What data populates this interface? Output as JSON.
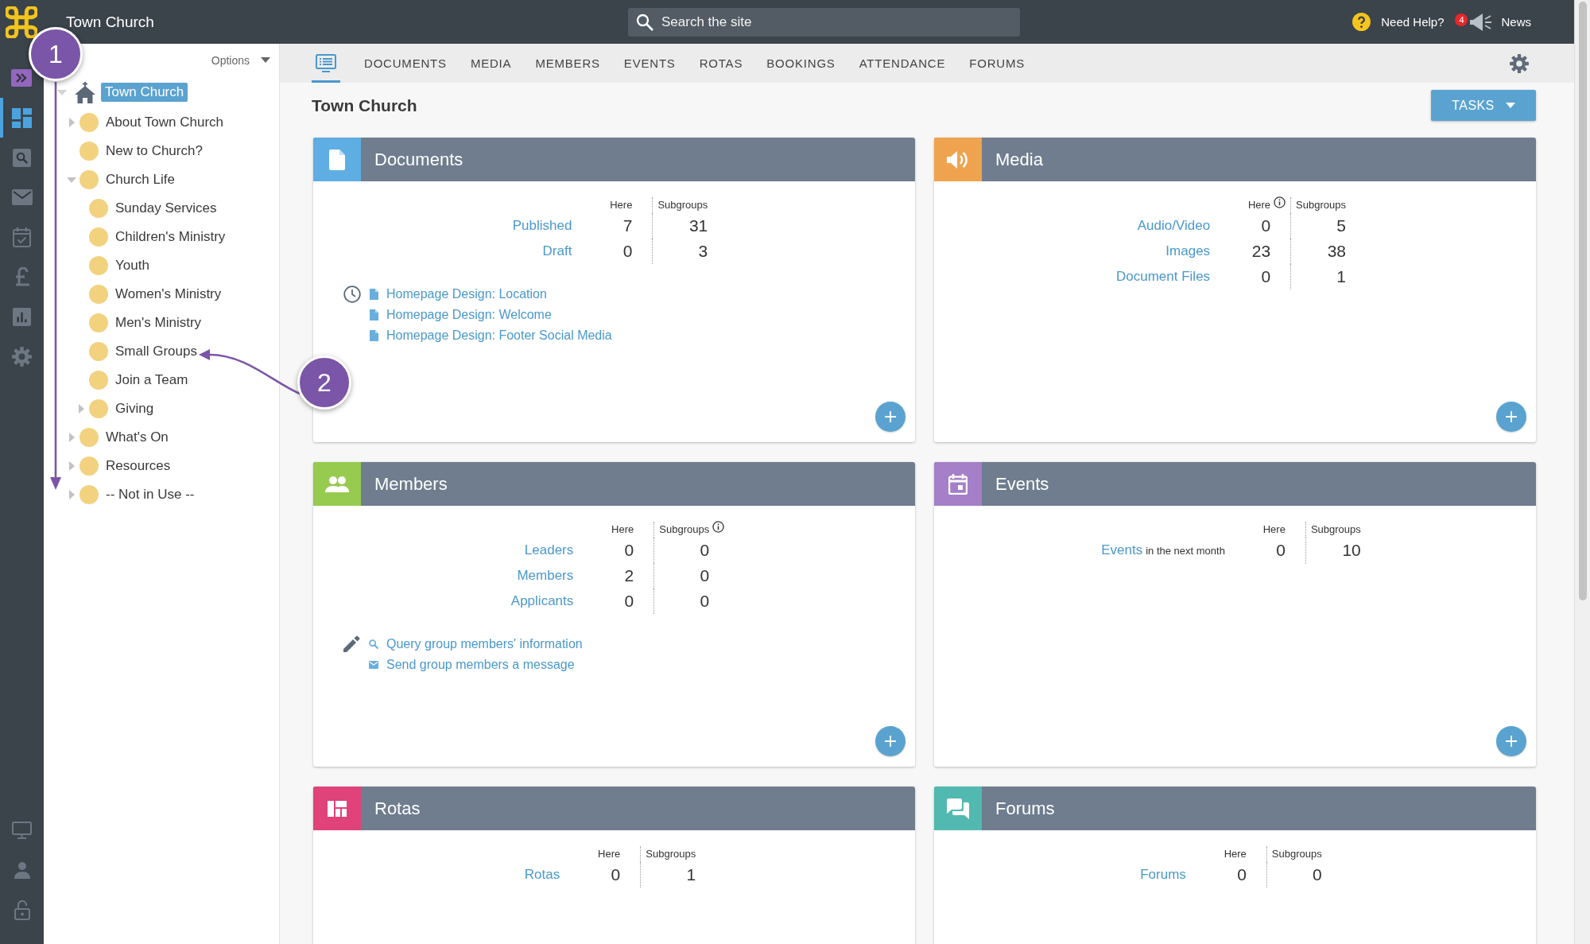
{
  "topbar": {
    "title": "Town Church",
    "search": {
      "placeholder": "Search the site"
    },
    "help": "Need Help?",
    "news": {
      "label": "News",
      "count": "4"
    }
  },
  "rail": {
    "items": [
      {
        "kind": "expand",
        "selected": false
      },
      {
        "kind": "dashboard",
        "selected": true
      },
      {
        "kind": "search",
        "selected": false
      },
      {
        "kind": "mail",
        "selected": false
      },
      {
        "kind": "calendar",
        "selected": false
      },
      {
        "kind": "finance",
        "selected": false
      },
      {
        "kind": "chart",
        "selected": false
      },
      {
        "kind": "settings",
        "selected": false
      }
    ],
    "bottom_items": [
      {
        "kind": "monitor",
        "selected": false
      },
      {
        "kind": "person",
        "selected": false
      },
      {
        "kind": "lock",
        "selected": false
      }
    ]
  },
  "tree": {
    "options": "Options",
    "nodes": [
      {
        "label": "Town Church",
        "kind": "home",
        "expandable": true,
        "expanded": true,
        "selected": true,
        "children": [
          {
            "label": "About Town Church",
            "kind": "page",
            "expandable": true,
            "expanded": false,
            "selected": false
          },
          {
            "label": "New to Church?",
            "kind": "page",
            "expandable": false,
            "expanded": false,
            "selected": false
          },
          {
            "label": "Church Life",
            "kind": "page",
            "expandable": true,
            "expanded": true,
            "selected": false,
            "children": [
              {
                "label": "Sunday Services",
                "kind": "page",
                "expandable": false,
                "expanded": false,
                "selected": false
              },
              {
                "label": "Children's Ministry",
                "kind": "page",
                "expandable": false,
                "expanded": false,
                "selected": false
              },
              {
                "label": "Youth",
                "kind": "page",
                "expandable": false,
                "expanded": false,
                "selected": false
              },
              {
                "label": "Women's Ministry",
                "kind": "page",
                "expandable": false,
                "expanded": false,
                "selected": false
              },
              {
                "label": "Men's Ministry",
                "kind": "page",
                "expandable": false,
                "expanded": false,
                "selected": false
              },
              {
                "label": "Small Groups",
                "kind": "page",
                "expandable": false,
                "expanded": false,
                "selected": false
              },
              {
                "label": "Join a Team",
                "kind": "page",
                "expandable": false,
                "expanded": false,
                "selected": false
              },
              {
                "label": "Giving",
                "kind": "page",
                "expandable": true,
                "expanded": false,
                "selected": false
              }
            ]
          },
          {
            "label": "What's On",
            "kind": "page",
            "expandable": true,
            "expanded": false,
            "selected": false
          },
          {
            "label": "Resources",
            "kind": "page",
            "expandable": true,
            "expanded": false,
            "selected": false
          },
          {
            "label": "-- Not in Use --",
            "kind": "page",
            "expandable": true,
            "expanded": false,
            "selected": false
          }
        ]
      }
    ]
  },
  "tabs": [
    {
      "kind": "icon",
      "selected": true
    },
    {
      "kind": "text",
      "label": "DOCUMENTS",
      "selected": false
    },
    {
      "kind": "text",
      "label": "MEDIA",
      "selected": false
    },
    {
      "kind": "text",
      "label": "MEMBERS",
      "selected": false
    },
    {
      "kind": "text",
      "label": "EVENTS",
      "selected": false
    },
    {
      "kind": "text",
      "label": "ROTAS",
      "selected": false
    },
    {
      "kind": "text",
      "label": "BOOKINGS",
      "selected": false
    },
    {
      "kind": "text",
      "label": "ATTENDANCE",
      "selected": false
    },
    {
      "kind": "text",
      "label": "FORUMS",
      "selected": false
    }
  ],
  "page": {
    "title": "Town Church",
    "tasks_button": "TASKS"
  },
  "cards": [
    {
      "kind": "documents",
      "title": "Documents",
      "color": "#5eaee3",
      "columns": [
        {
          "label": "Here",
          "info": false
        },
        {
          "label": "Subgroups",
          "info": false
        }
      ],
      "rows": [
        {
          "label": "Published",
          "here": "7",
          "subgroups": "31"
        },
        {
          "label": "Draft",
          "here": "0",
          "subgroups": "3"
        }
      ],
      "links": {
        "kind": "recent",
        "items": [
          {
            "kind": "document",
            "label": "Homepage Design: Location"
          },
          {
            "kind": "document",
            "label": "Homepage Design: Welcome"
          },
          {
            "kind": "document",
            "label": "Homepage Design: Footer Social Media"
          }
        ]
      },
      "add_button": true
    },
    {
      "kind": "media",
      "title": "Media",
      "color": "#f0a34f",
      "columns": [
        {
          "label": "Here",
          "info": true
        },
        {
          "label": "Subgroups",
          "info": false
        }
      ],
      "rows": [
        {
          "label": "Audio/Video",
          "here": "0",
          "subgroups": "5"
        },
        {
          "label": "Images",
          "here": "23",
          "subgroups": "38"
        },
        {
          "label": "Document Files",
          "here": "0",
          "subgroups": "1"
        }
      ],
      "add_button": true
    },
    {
      "kind": "members",
      "title": "Members",
      "color": "#96cb4f",
      "columns": [
        {
          "label": "Here",
          "info": false
        },
        {
          "label": "Subgroups",
          "info": true
        }
      ],
      "rows": [
        {
          "label": "Leaders",
          "here": "0",
          "subgroups": "0"
        },
        {
          "label": "Members",
          "here": "2",
          "subgroups": "0"
        },
        {
          "label": "Applicants",
          "here": "0",
          "subgroups": "0"
        }
      ],
      "links": {
        "kind": "actions",
        "items": [
          {
            "kind": "search",
            "label": "Query group members' information"
          },
          {
            "kind": "mail",
            "label": "Send group members a message"
          }
        ]
      },
      "add_button": true
    },
    {
      "kind": "events",
      "title": "Events",
      "color": "#a57fc7",
      "columns": [
        {
          "label": "Here",
          "info": false
        },
        {
          "label": "Subgroups",
          "info": false
        }
      ],
      "rows": [
        {
          "label": "Events",
          "note": "in the next month",
          "here": "0",
          "subgroups": "10"
        }
      ],
      "add_button": true
    },
    {
      "kind": "rotas",
      "title": "Rotas",
      "color": "#e0427a",
      "columns": [
        {
          "label": "Here",
          "info": false
        },
        {
          "label": "Subgroups",
          "info": false
        }
      ],
      "rows": [
        {
          "label": "Rotas",
          "here": "0",
          "subgroups": "1"
        }
      ],
      "add_button": false
    },
    {
      "kind": "forums",
      "title": "Forums",
      "color": "#52b9b0",
      "columns": [
        {
          "label": "Here",
          "info": false
        },
        {
          "label": "Subgroups",
          "info": false
        }
      ],
      "rows": [
        {
          "label": "Forums",
          "here": "0",
          "subgroups": "0"
        }
      ],
      "add_button": false
    }
  ],
  "callouts": [
    {
      "label": "1"
    },
    {
      "label": "2"
    }
  ]
}
